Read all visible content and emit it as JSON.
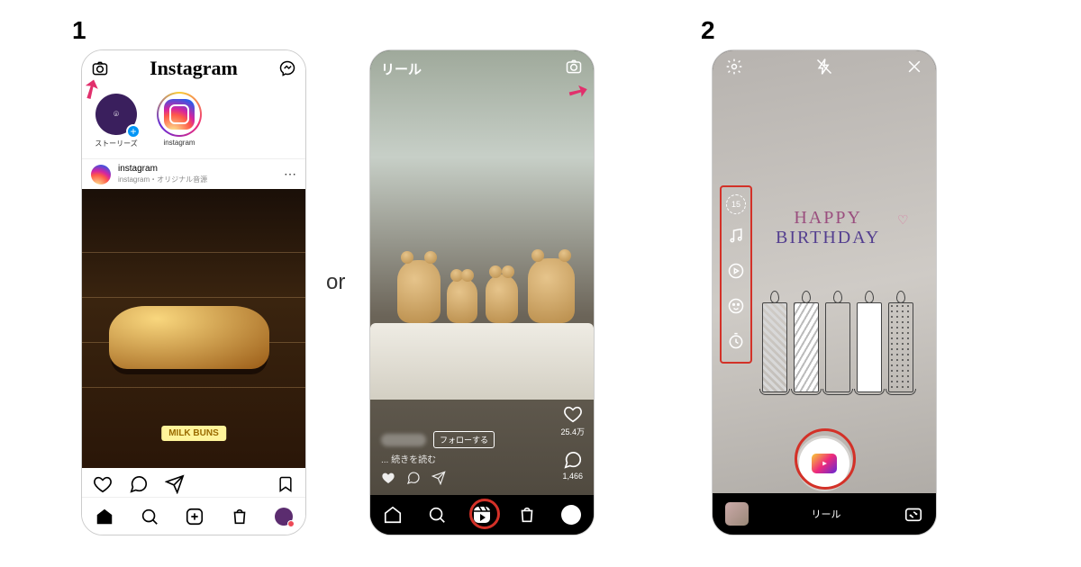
{
  "labels": {
    "step1": "1",
    "step2": "2",
    "separator": "or"
  },
  "screen1": {
    "logo": "Instagram",
    "stories": [
      {
        "label": "ストーリーズ"
      },
      {
        "label": "instagram"
      }
    ],
    "post": {
      "author": "instagram",
      "subtitle": "instagram・オリジナル音源",
      "caption": "MILK BUNS"
    }
  },
  "screen2": {
    "title": "リール",
    "follow": "フォローする",
    "readmore": "... 続きを読む",
    "likes": "25.4万",
    "comments": "1,466"
  },
  "screen3": {
    "toolbox": {
      "duration": "15"
    },
    "drawing": {
      "line1": "HAPPY",
      "line2": "BIRTHDAY"
    },
    "mode": "リール"
  }
}
